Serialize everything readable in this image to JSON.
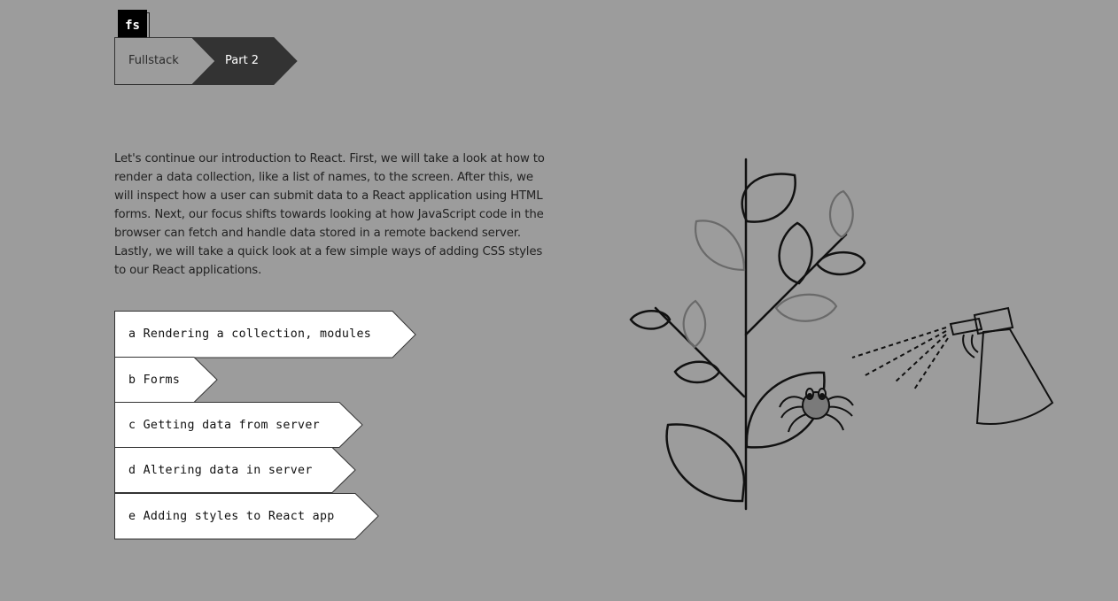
{
  "logo": {
    "text": "fs"
  },
  "breadcrumb": {
    "items": [
      {
        "label": "Fullstack"
      },
      {
        "label": "Part 2"
      }
    ]
  },
  "intro": {
    "text": "Let's continue our introduction to React. First, we will take a look at how to render a data collection, like a list of names, to the screen. After this, we will inspect how a user can submit data to a React application using HTML forms. Next, our focus shifts towards looking at how JavaScript code in the browser can fetch and handle data stored in a remote backend server. Lastly, we will take a quick look at a few simple ways of adding CSS styles to our React applications."
  },
  "parts": [
    {
      "letter": "a",
      "title": "Rendering a collection, modules"
    },
    {
      "letter": "b",
      "title": "Forms"
    },
    {
      "letter": "c",
      "title": "Getting data from server"
    },
    {
      "letter": "d",
      "title": "Altering data in server"
    },
    {
      "letter": "e",
      "title": "Adding styles to React app"
    }
  ],
  "illustration": {
    "icons": [
      "plant",
      "spider",
      "spray-bottle"
    ]
  },
  "colors": {
    "background": "#9c9c9c",
    "breadcrumb_active": "#333333",
    "card": "#ffffff"
  }
}
